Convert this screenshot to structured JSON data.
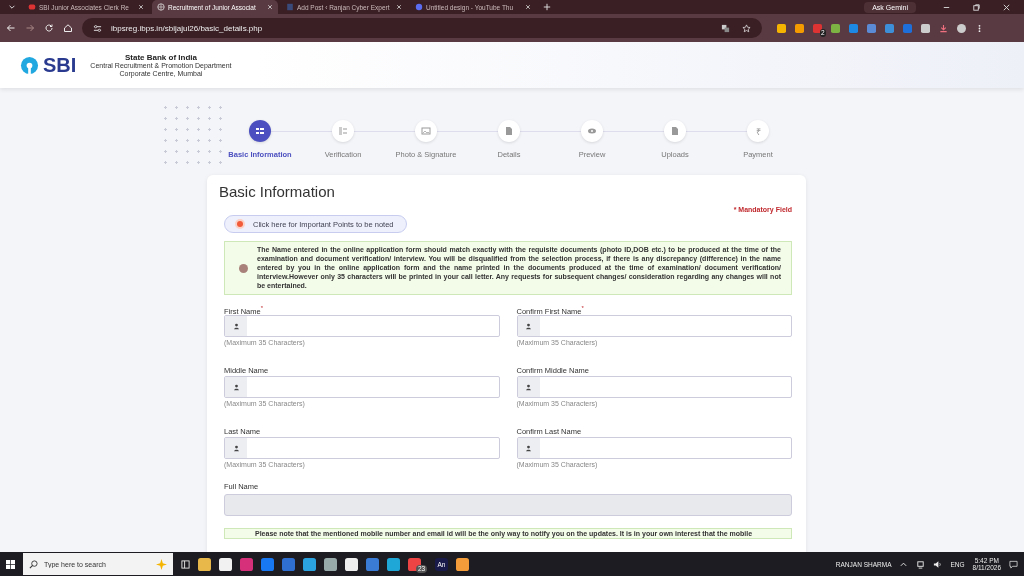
{
  "browser": {
    "tabs": [
      {
        "title": "SBI Junior Associates Clerk Re",
        "kind": "badge",
        "selected": false
      },
      {
        "title": "Recruitment of Junior Associat",
        "kind": "globe",
        "selected": true
      },
      {
        "title": "Add Post ‹ Ranjan Cyber Expert",
        "kind": "page",
        "selected": false
      },
      {
        "title": "Untitled design - YouTube Thu",
        "kind": "circle",
        "selected": false
      }
    ],
    "ask_gemini": "Ask Gemini",
    "url": "ibpsreg.ibps.in/sbijajul26/basic_details.php",
    "extension_badge": "2"
  },
  "site": {
    "logo": "SBI",
    "bank_name": "State Bank of India",
    "sub_lines": [
      "Central Recruitment & Promotion Department",
      "Corporate Centre, Mumbai"
    ]
  },
  "steps": [
    {
      "label": "Basic Information",
      "selected": true,
      "kind": "list"
    },
    {
      "label": "Verification",
      "selected": false,
      "kind": "checklist"
    },
    {
      "label": "Photo & Signature",
      "selected": false,
      "kind": "image"
    },
    {
      "label": "Details",
      "selected": false,
      "kind": "document"
    },
    {
      "label": "Preview",
      "selected": false,
      "kind": "eye"
    },
    {
      "label": "Uploads",
      "selected": false,
      "kind": "document"
    },
    {
      "label": "Payment",
      "selected": false,
      "kind": "rupee",
      "symbol": "₹"
    }
  ],
  "form": {
    "title": "Basic Information",
    "mandatory": "* Mandatory Field",
    "important_button": "Click here for Important Points to be noted",
    "notice": "The Name entered in the online application form should match exactly with the requisite documents (photo ID,DOB etc.) to be produced at the time of the examination and document verification/ interview. You will be disqualified from the selection process, if there is any discrepancy (difference) in the name entered by you in the online application form and the name printed in the documents produced at the time of examination/ document verification/ interview.However only 35 characters will be printed in your call letter. Any requests for subsequent changes/ consideration regarding any changes will not be entertained.",
    "fields": [
      {
        "label": "First Name",
        "required_mark": "*",
        "hint": "(Maximum 35 Characters)"
      },
      {
        "label": "Confirm First Name",
        "required_mark": "*",
        "hint": "(Maximum 35 Characters)"
      },
      {
        "label": "Middle Name",
        "hint": "(Maximum 35 Characters)"
      },
      {
        "label": "Confirm Middle Name",
        "hint": "(Maximum 35 Characters)"
      },
      {
        "label": "Last Name",
        "hint": "(Maximum 35 Characters)"
      },
      {
        "label": "Confirm Last Name",
        "hint": "(Maximum 35 Characters)"
      }
    ],
    "full_name": {
      "label": "Full Name",
      "disabled": true
    },
    "bottom_note": "Please note that the mentioned mobile number and email id will be the only way to notify you on the updates. It is in your own interest that the mobile"
  },
  "taskbar": {
    "search_placeholder": "Type here to search",
    "app_badge": "23",
    "app_label": "An",
    "user": "RANJAN SHARMA",
    "language": "ENG",
    "time": "5:42 PM",
    "date": "8/11/2026"
  }
}
